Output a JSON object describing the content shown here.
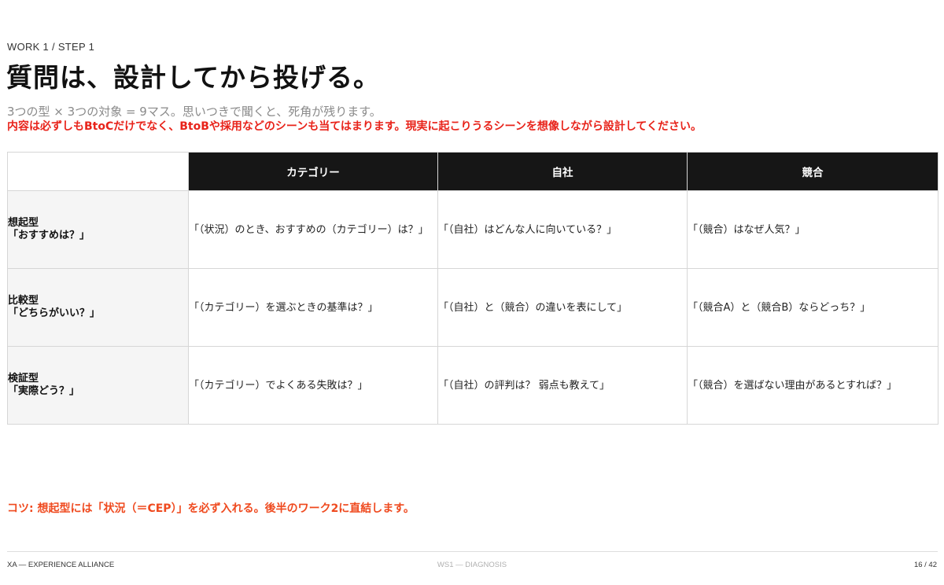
{
  "header": {
    "eyebrow": "WORK 1 / STEP 1",
    "title": "質問は、設計してから投げる。",
    "subtitle": "3つの型 × 3つの対象 = 9マス。思いつきで聞くと、死角が残ります。",
    "note": "内容は必ずしもBtoCだけでなく、BtoBや採用などのシーンも当てはまります。現実に起こりうるシーンを想像しながら設計してください。"
  },
  "matrix": {
    "columns": [
      "カテゴリー",
      "自社",
      "競合"
    ],
    "rows": [
      {
        "type": "想起型",
        "question": "「おすすめは？」",
        "cells": [
          "「（状況）のとき、おすすめの（カテゴリー）は？」",
          "「（自社）はどんな人に向いている？」",
          "「（競合）はなぜ人気？」"
        ]
      },
      {
        "type": "比較型",
        "question": "「どちらがいい？」",
        "cells": [
          "「（カテゴリー）を選ぶときの基準は？」",
          "「（自社）と（競合）の違いを表にして」",
          "「（競合A）と（競合B）ならどっち？」"
        ]
      },
      {
        "type": "検証型",
        "question": "「実際どう？」",
        "cells": [
          "「（カテゴリー）でよくある失敗は？」",
          "「（自社）の評判は？ 弱点も教えて」",
          "「（競合）を選ばない理由があるとすれば？」"
        ]
      }
    ]
  },
  "tip": "コツ: 想起型には「状況（＝CEP）」を必ず入れる。後半のワーク2に直結します。",
  "footer": {
    "left": "XA — EXPERIENCE ALLIANCE",
    "center": "WS1 — DIAGNOSIS",
    "right": "16 / 42"
  },
  "colors": {
    "header_bg": "#161616",
    "accent_red": "#e8231a",
    "tip_orange": "#ef4a1f",
    "row_header_bg": "#f5f5f5"
  }
}
